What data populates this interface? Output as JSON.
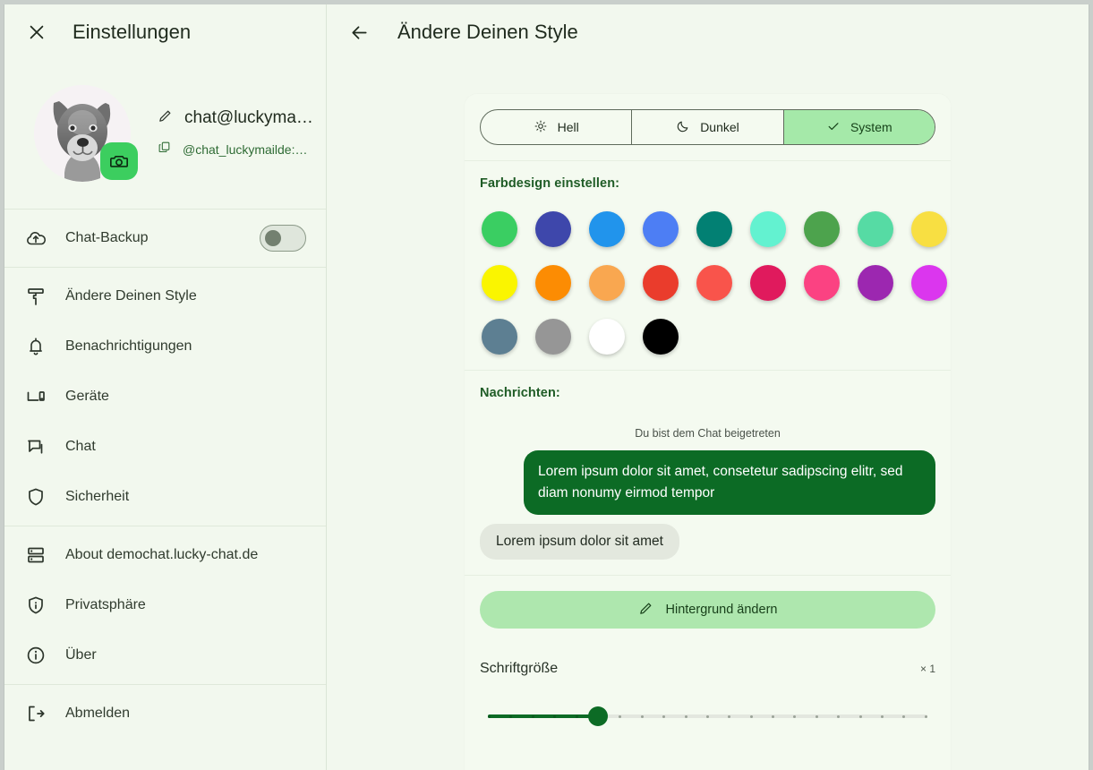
{
  "sidebar": {
    "header": {
      "close_icon": "close-icon",
      "title": "Einstellungen"
    },
    "profile": {
      "avatar_alt": "dog-avatar",
      "camera_icon": "camera-icon",
      "edit_icon": "pencil-icon",
      "display_name": "chat@luckyma…",
      "copy_icon": "copy-icon",
      "handle": "@chat_luckymailde:…"
    },
    "backup": {
      "label": "Chat-Backup",
      "icon": "cloud-upload-icon",
      "toggle_on": false
    },
    "items_main": [
      {
        "label": "Ändere Deinen Style",
        "icon": "paint-roller-icon"
      },
      {
        "label": "Benachrichtigungen",
        "icon": "bell-icon"
      },
      {
        "label": "Geräte",
        "icon": "devices-icon"
      },
      {
        "label": "Chat",
        "icon": "chat-bubble-icon"
      },
      {
        "label": "Sicherheit",
        "icon": "shield-icon"
      }
    ],
    "items_about": [
      {
        "label": "About demochat.lucky-chat.de",
        "icon": "server-icon"
      },
      {
        "label": "Privatsphäre",
        "icon": "shield-info-icon"
      },
      {
        "label": "Über",
        "icon": "info-circle-icon"
      }
    ],
    "items_footer": [
      {
        "label": "Abmelden",
        "icon": "logout-icon"
      }
    ]
  },
  "main": {
    "header": {
      "back_icon": "arrow-left-icon",
      "title": "Ändere Deinen Style"
    },
    "theme": {
      "options": [
        {
          "label": "Hell",
          "icon": "sun-icon",
          "selected": false
        },
        {
          "label": "Dunkel",
          "icon": "moon-icon",
          "selected": false
        },
        {
          "label": "System",
          "icon": "check-icon",
          "selected": true
        }
      ]
    },
    "colors": {
      "title": "Farbdesign einstellen:",
      "swatches": [
        "#3ace62",
        "#3e47ab",
        "#2194ec",
        "#4d7ef4",
        "#028073",
        "#63f2d0",
        "#4da34d",
        "#56dba4",
        "#f8df42",
        "#faf500",
        "#fc8c03",
        "#f9a750",
        "#ea3c2c",
        "#f9544b",
        "#e01a5d",
        "#fb4282",
        "#9c27b0",
        "#db36ee",
        "#5d7f92",
        "#969696",
        "#ffffff",
        "#000000"
      ]
    },
    "messages": {
      "title": "Nachrichten:",
      "system_text": "Du bist dem Chat beigetreten",
      "outgoing_text": "Lorem ipsum dolor sit amet, consetetur sadipscing elitr, sed diam nonumy eirmod tempor",
      "incoming_text": "Lorem ipsum dolor sit amet"
    },
    "background": {
      "label": "Hintergrund ändern",
      "icon": "pencil-icon"
    },
    "fontsize": {
      "label": "Schriftgröße",
      "value_label": "× 1",
      "ticks_total": 21,
      "ticks_filled": 6,
      "thumb_percent": 25
    }
  }
}
